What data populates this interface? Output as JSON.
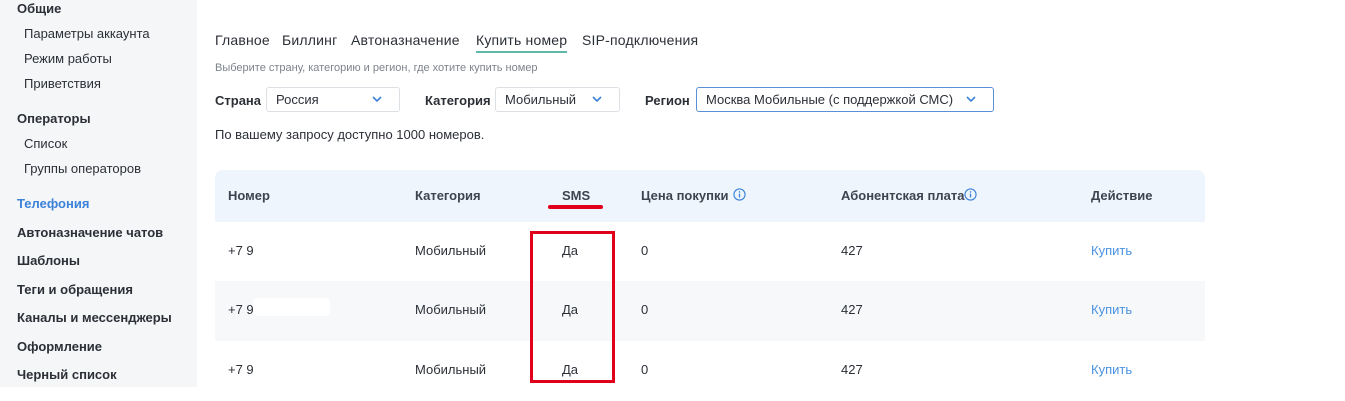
{
  "sidebar": {
    "general_heading": "Общие",
    "general_items": [
      "Параметры аккаунта",
      "Режим работы",
      "Приветствия"
    ],
    "operators_heading": "Операторы",
    "operators_items": [
      "Список",
      "Группы операторов"
    ],
    "nav_items": [
      "Телефония",
      "Автоназначение чатов",
      "Шаблоны",
      "Теги и обращения",
      "Каналы и мессенджеры",
      "Оформление",
      "Черный список"
    ],
    "active_item": "Телефония"
  },
  "tabs": [
    "Главное",
    "Биллинг",
    "Автоназначение",
    "Купить номер",
    "SIP-подключения"
  ],
  "active_tab": "Купить номер",
  "hint": "Выберите страну, категорию и регион, где хотите купить номер",
  "filters": {
    "country_label": "Страна",
    "country_value": "Россия",
    "category_label": "Категория",
    "category_value": "Мобильный",
    "region_label": "Регион",
    "region_value": "Москва Мобильные (с поддержкой СМС)"
  },
  "result_text": "По вашему запросу доступно 1000 номеров.",
  "table": {
    "headers": [
      "Номер",
      "Категория",
      "SMS",
      "Цена покупки",
      "Абонентская плата",
      "Действие"
    ],
    "rows": [
      {
        "number": "+7 9",
        "category": "Мобильный",
        "sms": "Да",
        "price": "0",
        "fee": "427",
        "action": "Купить"
      },
      {
        "number": "+7 9",
        "category": "Мобильный",
        "sms": "Да",
        "price": "0",
        "fee": "427",
        "action": "Купить"
      },
      {
        "number": "+7 9",
        "category": "Мобильный",
        "sms": "Да",
        "price": "0",
        "fee": "427",
        "action": "Купить"
      }
    ]
  },
  "colors": {
    "accent": "#3b82d8",
    "link": "#4a93e2",
    "tab_underline": "#5fb8a8",
    "annotation": "#e0001b",
    "table_header_bg": "#eef5fc"
  },
  "icons": {
    "chevron": "chevron-down-icon",
    "info": "info-icon"
  }
}
